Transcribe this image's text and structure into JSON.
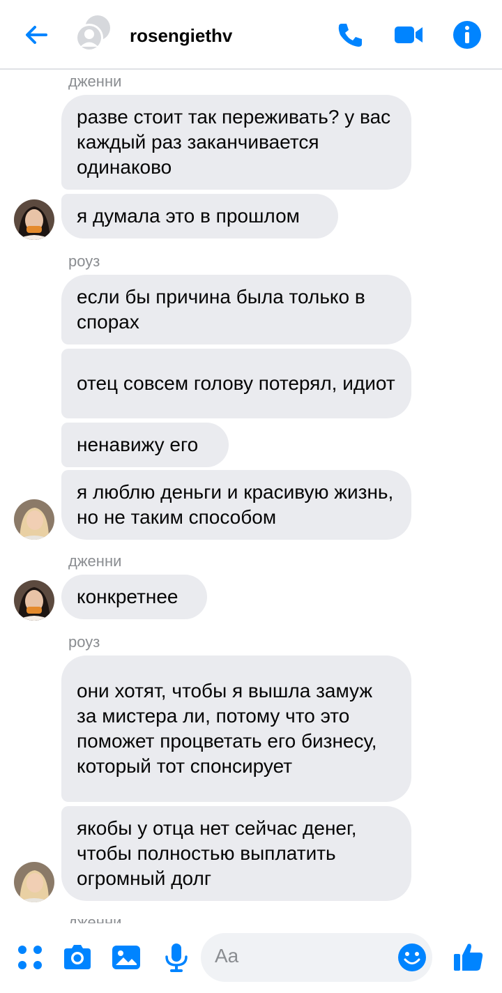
{
  "header": {
    "contact_name": "rosengiethv",
    "icons": [
      "back-arrow-icon",
      "group-avatar-icon",
      "phone-icon",
      "video-camera-icon",
      "info-icon"
    ],
    "accent_color": "#0084ff"
  },
  "messages": {
    "groups": [
      {
        "sender": "дженни",
        "avatar": "jennie-avatar",
        "bubbles": [
          "разве стоит так переживать? у вас каждый раз заканчивается одинаково",
          "я думала это в прошлом"
        ]
      },
      {
        "sender": "роуз",
        "avatar": "rose-avatar",
        "bubbles": [
          "если бы причина была только в спорах",
          "отец совсем голову потерял, идиот",
          "ненавижу его",
          "я люблю деньги и красивую жизнь, но не таким способом"
        ]
      },
      {
        "sender": "дженни",
        "avatar": "jennie-avatar",
        "bubbles": [
          "конкретнее"
        ]
      },
      {
        "sender": "роуз",
        "avatar": "rose-avatar",
        "bubbles": [
          "они хотят, чтобы я вышла замуж за мистера ли, потому что это поможет процветать его бизнесу, который тот спонсирует",
          "якобы у отца нет сейчас денег, чтобы полностью выплатить огромный долг"
        ]
      },
      {
        "sender": "дженни",
        "avatar": "jennie-avatar",
        "bubbles": []
      }
    ]
  },
  "composer": {
    "placeholder": "Aa",
    "icons": [
      "menu-dots-icon",
      "camera-icon",
      "gallery-icon",
      "microphone-icon",
      "emoji-icon",
      "thumbs-up-icon"
    ]
  }
}
